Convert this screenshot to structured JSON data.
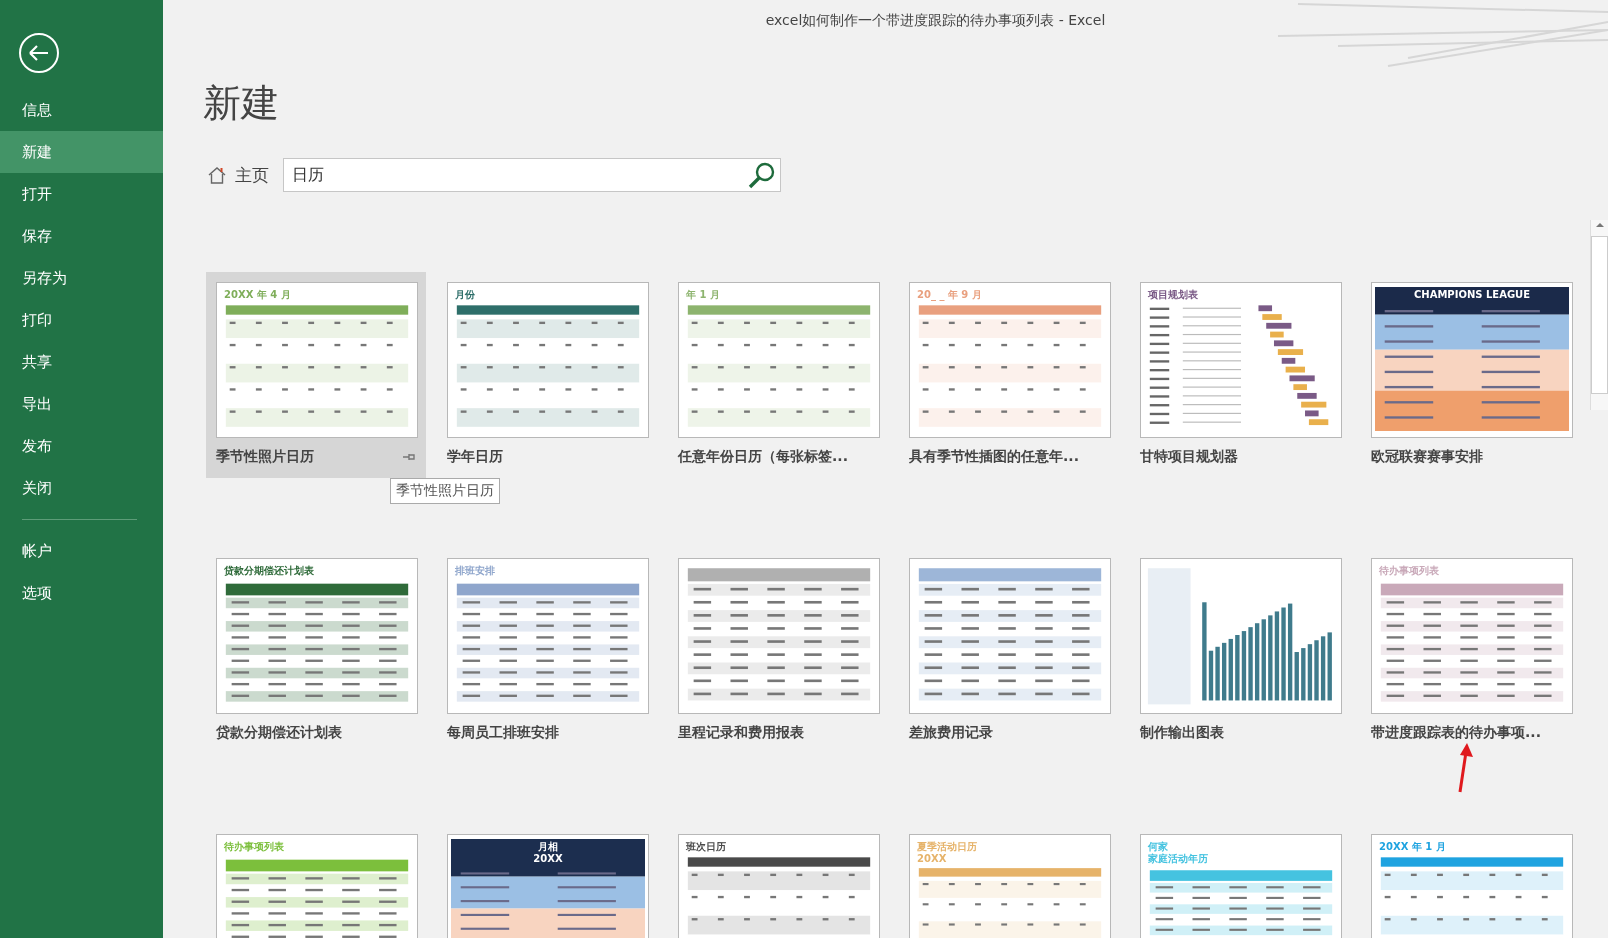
{
  "window": {
    "title": "excel如何制作一个带进度跟踪的待办事项列表 - Excel"
  },
  "sidebar": {
    "items": [
      {
        "label": "信息",
        "selected": false
      },
      {
        "label": "新建",
        "selected": true
      },
      {
        "label": "打开",
        "selected": false
      },
      {
        "label": "保存",
        "selected": false
      },
      {
        "label": "另存为",
        "selected": false
      },
      {
        "label": "打印",
        "selected": false
      },
      {
        "label": "共享",
        "selected": false
      },
      {
        "label": "导出",
        "selected": false
      },
      {
        "label": "发布",
        "selected": false
      },
      {
        "label": "关闭",
        "selected": false
      }
    ],
    "bottom_items": [
      {
        "label": "帐户",
        "selected": false
      },
      {
        "label": "选项",
        "selected": false
      }
    ]
  },
  "page": {
    "heading": "新建",
    "home_link": "主页",
    "search": {
      "value": "日历"
    }
  },
  "tooltip": "季节性照片日历",
  "templates": [
    {
      "name": "季节性照片日历",
      "selected": true,
      "kind": "calendar",
      "color": "#7fae5a",
      "heading": "20XX 年 4 月"
    },
    {
      "name": "学年日历",
      "selected": false,
      "kind": "calendar",
      "color": "#2e6f6a",
      "heading": "月份"
    },
    {
      "name": "任意年份日历（每张标签...",
      "selected": false,
      "kind": "calendar",
      "color": "#8db46e",
      "heading": "年 1 月"
    },
    {
      "name": "具有季节性插图的任意年...",
      "selected": false,
      "kind": "calendar",
      "color": "#e9a07f",
      "heading": "20_ _ 年 9 月"
    },
    {
      "name": "甘特项目规划器",
      "selected": false,
      "kind": "gantt",
      "color": "#7a5a86",
      "heading": "项目规划表"
    },
    {
      "name": "欧冠联赛赛事安排",
      "selected": false,
      "kind": "banner",
      "color": "#1b2a4a",
      "heading": "CHAMPIONS LEAGUE"
    },
    {
      "name": "贷款分期偿还计划表",
      "selected": false,
      "kind": "table",
      "color": "#2f6b3a",
      "heading": "贷款分期偿还计划表"
    },
    {
      "name": "每周员工排班安排",
      "selected": false,
      "kind": "table",
      "color": "#8fa6cc",
      "heading": "排班安排"
    },
    {
      "name": "里程记录和费用报表",
      "selected": false,
      "kind": "table",
      "color": "#b0b0b0"
    },
    {
      "name": "差旅费用记录",
      "selected": false,
      "kind": "table",
      "color": "#9db6d8"
    },
    {
      "name": "制作输出图表",
      "selected": false,
      "kind": "chart",
      "color": "#3f7b8c"
    },
    {
      "name": "带进度跟踪表的待办事项...",
      "selected": false,
      "kind": "table",
      "color": "#c9a9b9",
      "heading": "待办事项列表"
    },
    {
      "selected": false,
      "kind": "table",
      "color": "#7cbf3c",
      "heading": "待办事项列表"
    },
    {
      "selected": false,
      "kind": "banner",
      "color": "#1c2e4f",
      "heading": [
        "月相",
        "20XX"
      ]
    },
    {
      "selected": false,
      "kind": "calendar",
      "color": "#4a4a4a",
      "heading": "班次日历"
    },
    {
      "selected": false,
      "kind": "calendar",
      "color": "#e6b36a",
      "heading": [
        "夏季活动日历",
        "20XX"
      ]
    },
    {
      "selected": false,
      "kind": "table",
      "color": "#45c3e0",
      "heading": [
        "何家",
        "家庭活动年历"
      ]
    },
    {
      "selected": false,
      "kind": "calendar",
      "color": "#1fa3e0",
      "heading": "20XX 年 1 月"
    }
  ]
}
